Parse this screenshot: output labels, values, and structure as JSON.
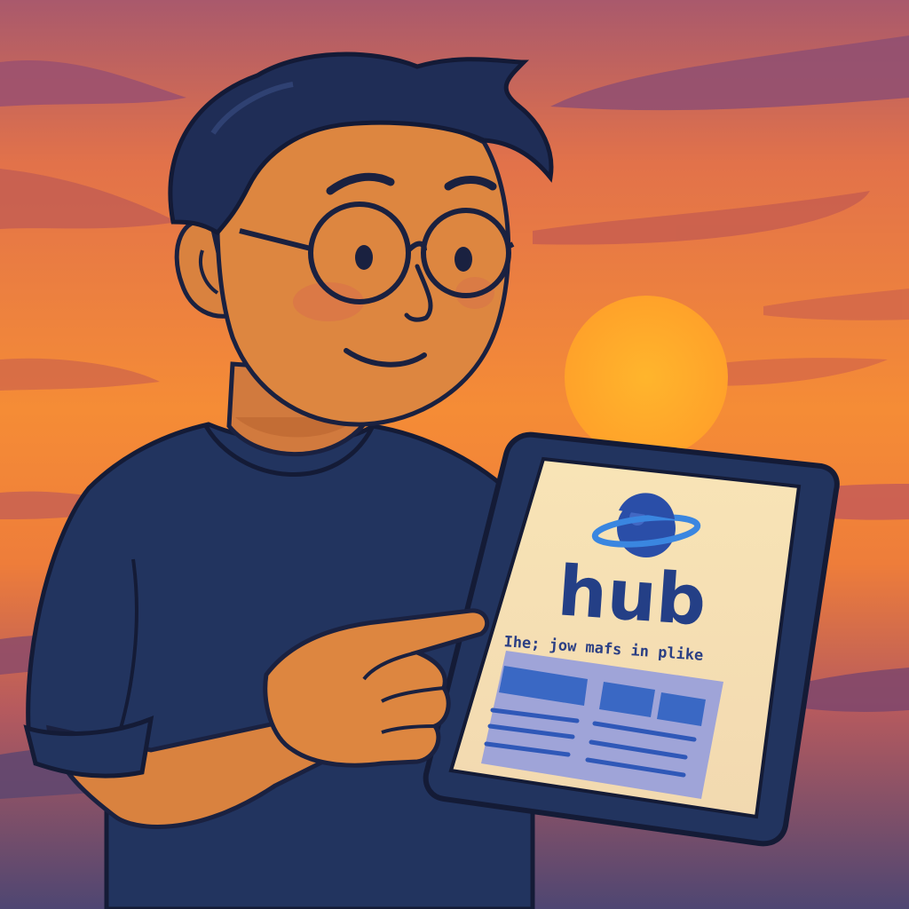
{
  "tablet": {
    "app_name": "hub",
    "tagline": "Ihe; jow mafs in plike",
    "logo_icon": "planet-icon"
  },
  "colors": {
    "sky_top": "#b35f6b",
    "sky_mid": "#f08a3a",
    "sky_bottom": "#5a4a78",
    "sun": "#ffb02e",
    "shirt": "#22345f",
    "hair": "#1f2d56",
    "skin": "#d9823f",
    "outline": "#1a2140",
    "screen": "#f7e1b4",
    "brand_blue": "#243f86",
    "ui_panel": "#9fa4d8",
    "ui_block": "#3a68c4"
  }
}
